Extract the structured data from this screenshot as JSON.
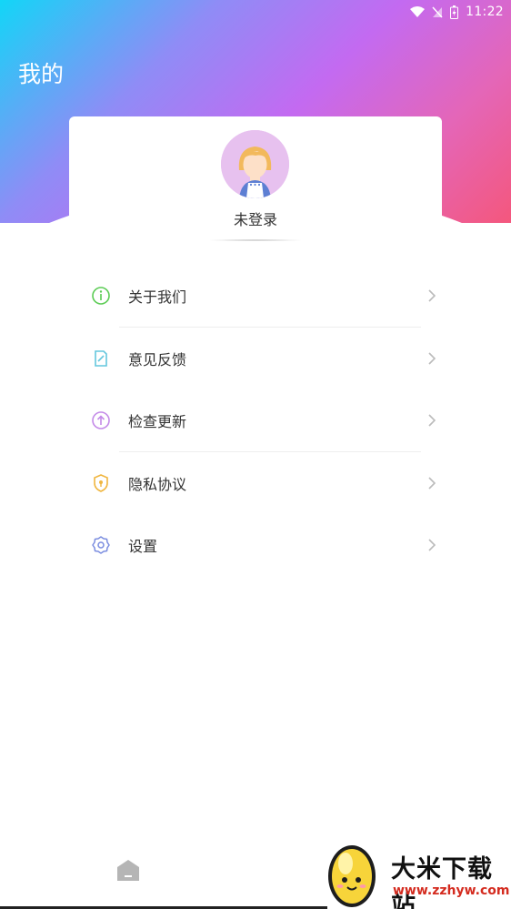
{
  "status_bar": {
    "time": "11:22",
    "icons": [
      "wifi-icon",
      "signal-icon",
      "battery-icon"
    ]
  },
  "header": {
    "title": "我的"
  },
  "profile": {
    "status_label": "未登录",
    "avatar": "avatar-girl"
  },
  "menu": {
    "items": [
      {
        "label": "关于我们",
        "icon": "info-icon",
        "color": "#5ccc55"
      },
      {
        "label": "意见反馈",
        "icon": "feedback-icon",
        "color": "#64c7dd"
      },
      {
        "label": "检查更新",
        "icon": "update-icon",
        "color": "#c48be8"
      },
      {
        "label": "隐私协议",
        "icon": "shield-icon",
        "color": "#f0b640"
      },
      {
        "label": "设置",
        "icon": "settings-icon",
        "color": "#7b8de0"
      }
    ]
  },
  "bottom_nav": {
    "home_icon": "home-icon"
  },
  "watermark": {
    "title": "大米下载站",
    "url": "www.zzhyw.com"
  },
  "colors": {
    "gradient": [
      "#12d6f7",
      "#c36af1",
      "#f4577d"
    ],
    "chevron": "#bbbbbb"
  }
}
